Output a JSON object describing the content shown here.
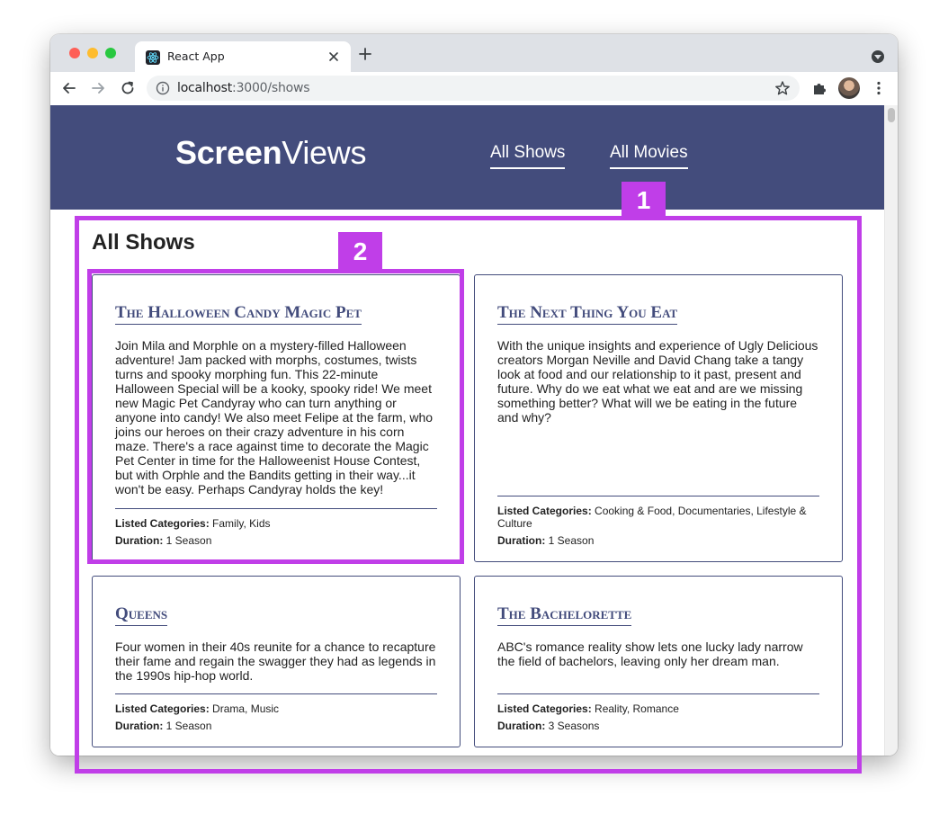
{
  "browser": {
    "tab_title": "React App",
    "url_host": "localhost",
    "url_rest": ":3000/shows"
  },
  "site": {
    "logo_bold": "Screen",
    "logo_light": "Views",
    "nav": [
      {
        "label": "All Shows"
      },
      {
        "label": "All Movies"
      }
    ]
  },
  "page_title": "All Shows",
  "shows": [
    {
      "title": "The Halloween Candy Magic Pet",
      "description": "Join Mila and Morphle on a mystery-filled Halloween adventure! Jam packed with morphs, costumes, twists turns and spooky morphing fun. This 22-minute Halloween Special will be a kooky, spooky ride! We meet new Magic Pet Candyray who can turn anything or anyone into candy! We also meet Felipe at the farm, who joins our heroes on their crazy adventure in his corn maze. There's a race against time to decorate the Magic Pet Center in time for the Halloweenist House Contest, but with Orphle and the Bandits getting in their way...it won't be easy. Perhaps Candyray holds the key!",
      "categories": "Family, Kids",
      "duration": "1 Season"
    },
    {
      "title": "The Next Thing You Eat",
      "description": "With the unique insights and experience of Ugly Delicious creators Morgan Neville and David Chang take a tangy look at food and our relationship to it past, present and future. Why do we eat what we eat and are we missing something better? What will we be eating in the future and why?",
      "categories": "Cooking & Food, Documentaries, Lifestyle & Culture",
      "duration": "1 Season"
    },
    {
      "title": "Queens",
      "description": "Four women in their 40s reunite for a chance to recapture their fame and regain the swagger they had as legends in the 1990s hip-hop world.",
      "categories": "Drama, Music",
      "duration": "1 Season"
    },
    {
      "title": "The Bachelorette",
      "description": "ABC's romance reality show lets one lucky lady narrow the field of bachelors, leaving only her dream man.",
      "categories": "Reality, Romance",
      "duration": "3 Seasons"
    }
  ],
  "labels": {
    "categories": "Listed Categories:",
    "duration": "Duration:"
  },
  "annotations": [
    {
      "label": "1"
    },
    {
      "label": "2"
    }
  ],
  "colors": {
    "brand": "#434c7c",
    "annotation": "#c03ee8"
  }
}
